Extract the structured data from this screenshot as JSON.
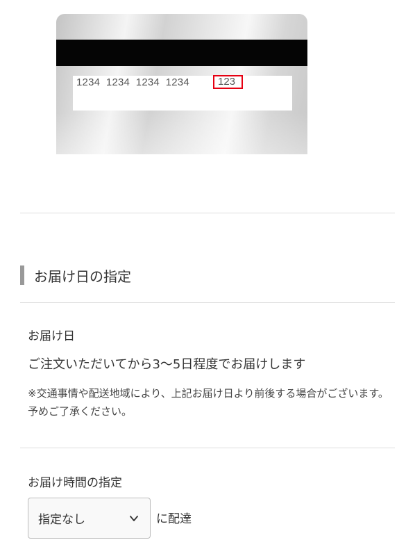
{
  "card_image": {
    "number_groups": "1234  1234  1234  1234",
    "security_code": "123",
    "highlight_color": "#e60012"
  },
  "delivery_section": {
    "title": "お届け日の指定",
    "date_label": "お届け日",
    "date_text": "ご注文いただいてから3〜5日程度でお届けします",
    "note": "※交通事情や配送地域により、上記お届け日より前後する場合がございます。予めご了承ください。"
  },
  "time_section": {
    "label": "お届け時間の指定",
    "select": {
      "value": "指定なし",
      "icon": "chevron-down-icon"
    },
    "suffix": "に配達"
  }
}
